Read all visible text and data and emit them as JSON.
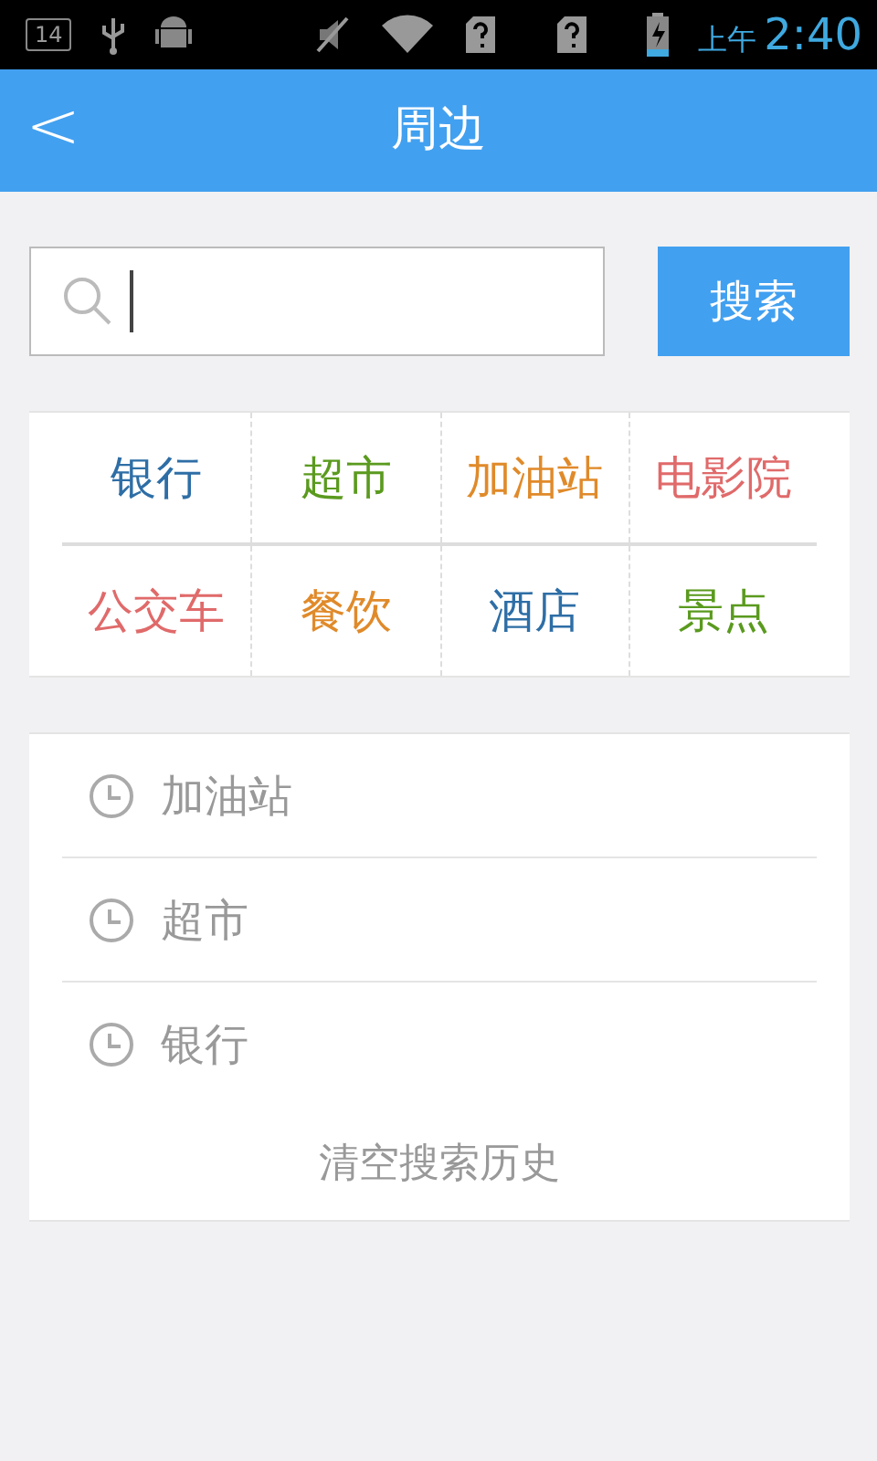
{
  "status_bar": {
    "notification_count": "14",
    "period": "上午",
    "time": "2:40"
  },
  "header": {
    "back": "<",
    "title": "周边"
  },
  "search": {
    "button": "搜索"
  },
  "categories": [
    {
      "label": "银行",
      "color": "#2e6ea6"
    },
    {
      "label": "超市",
      "color": "#5a9a1e"
    },
    {
      "label": "加油站",
      "color": "#e08a2a"
    },
    {
      "label": "电影院",
      "color": "#e06a6a"
    },
    {
      "label": "公交车",
      "color": "#e06a6a"
    },
    {
      "label": "餐饮",
      "color": "#e08a2a"
    },
    {
      "label": "酒店",
      "color": "#2e6ea6"
    },
    {
      "label": "景点",
      "color": "#5a9a1e"
    }
  ],
  "history": [
    "加油站",
    "超市",
    "银行"
  ],
  "clear_history": "清空搜索历史"
}
